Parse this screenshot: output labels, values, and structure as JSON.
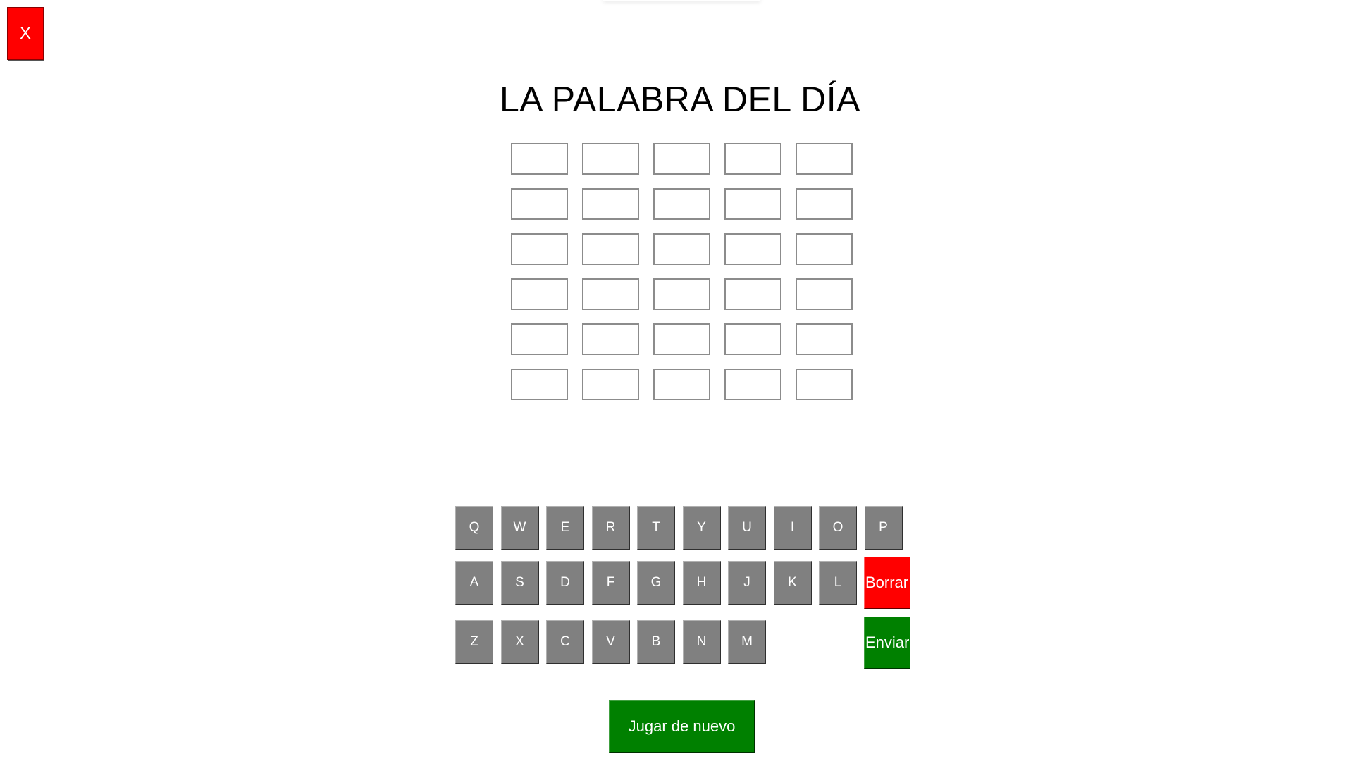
{
  "close_button": {
    "label": "X",
    "color": "#ff0000"
  },
  "title": "LA PALABRA DEL DÍA",
  "board": {
    "rows": [
      [
        "",
        "",
        "",
        "",
        ""
      ],
      [
        "",
        "",
        "",
        "",
        ""
      ],
      [
        "",
        "",
        "",
        "",
        ""
      ],
      [
        "",
        "",
        "",
        "",
        ""
      ],
      [
        "",
        "",
        "",
        "",
        ""
      ],
      [
        "",
        "",
        "",
        "",
        ""
      ]
    ]
  },
  "keyboard": {
    "row1": [
      "Q",
      "W",
      "E",
      "R",
      "T",
      "Y",
      "U",
      "I",
      "O",
      "P"
    ],
    "row2": [
      "A",
      "S",
      "D",
      "F",
      "G",
      "H",
      "J",
      "K",
      "L"
    ],
    "row3": [
      "Z",
      "X",
      "C",
      "V",
      "B",
      "N",
      "M"
    ],
    "delete_label": "Borrar",
    "send_label": "Enviar",
    "key_color": "#808080",
    "delete_color": "#ff0000",
    "send_color": "#008000"
  },
  "play_again_label": "Jugar de nuevo"
}
